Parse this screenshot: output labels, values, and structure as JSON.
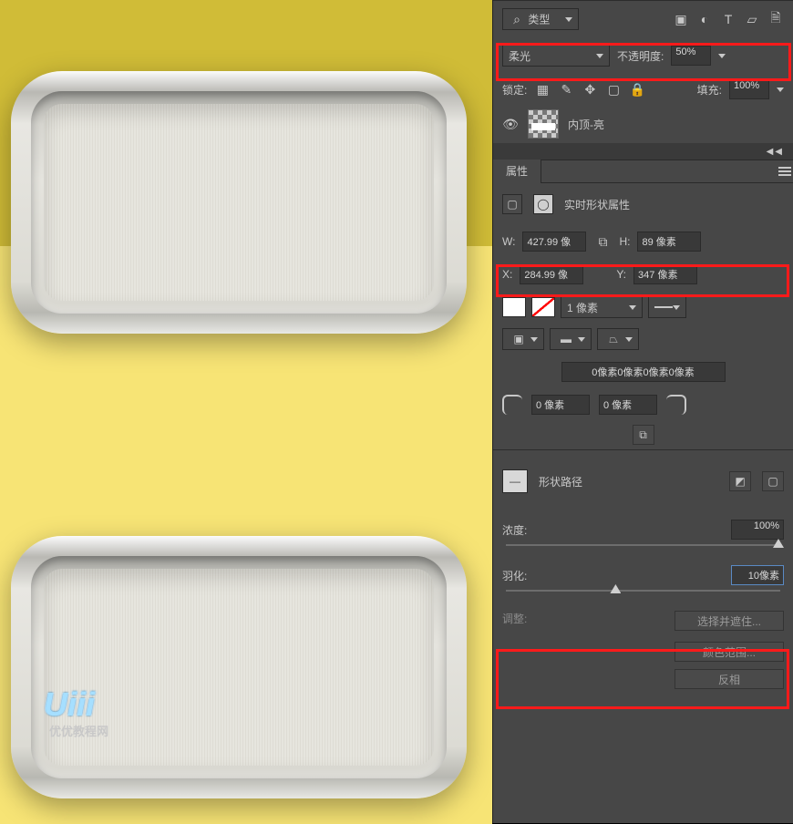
{
  "filter_row": {
    "search_label": "类型"
  },
  "layers": {
    "blend_mode": "柔光",
    "opacity_label": "不透明度:",
    "opacity_value": "50%",
    "lock_label": "锁定:",
    "fill_label": "填充:",
    "fill_value": "100%",
    "layer_name": "内顶-亮"
  },
  "props": {
    "tab": "属性",
    "title": "实时形状属性",
    "W_label": "W:",
    "W": "427.99 像",
    "H_label": "H:",
    "H": "89 像素",
    "X_label": "X:",
    "X": "284.99 像",
    "Y_label": "Y:",
    "Y": "347 像素",
    "stroke": "1 像素",
    "radius_join": "0像素0像素0像素0像素",
    "radius_a": "0 像素",
    "radius_b": "0 像素"
  },
  "masks": {
    "title": "形状路径",
    "density_label": "浓度:",
    "density": "100%",
    "feather_label": "羽化:",
    "feather": "10像素",
    "adjust_label": "调整:",
    "btn_select": "选择并遮住...",
    "btn_color_range": "颜色范围...",
    "btn_invert": "反相"
  },
  "watermark": {
    "logo": "Uiii",
    "sub": "优优教程网"
  }
}
